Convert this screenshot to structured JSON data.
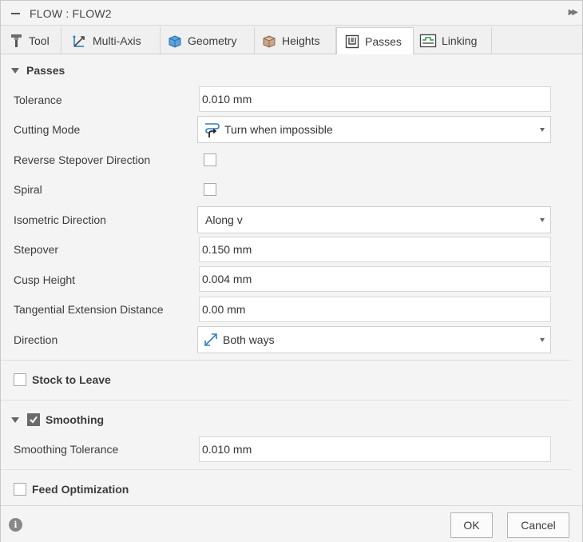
{
  "window": {
    "title": "FLOW : FLOW2"
  },
  "tabs": [
    {
      "label": "Tool",
      "icon": "tool-icon",
      "active": false
    },
    {
      "label": "Multi-Axis",
      "icon": "multi-axis-icon",
      "active": false
    },
    {
      "label": "Geometry",
      "icon": "geometry-icon",
      "active": false
    },
    {
      "label": "Heights",
      "icon": "heights-icon",
      "active": false
    },
    {
      "label": "Passes",
      "icon": "passes-icon",
      "active": true
    },
    {
      "label": "Linking",
      "icon": "linking-icon",
      "active": false
    }
  ],
  "passes": {
    "title": "Passes",
    "tolerance": {
      "label": "Tolerance",
      "value": "0.010 mm"
    },
    "cutting_mode": {
      "label": "Cutting Mode",
      "value": "Turn when impossible",
      "icon": "turn-when-impossible-icon"
    },
    "reverse_stepover": {
      "label": "Reverse Stepover Direction",
      "checked": false
    },
    "spiral": {
      "label": "Spiral",
      "checked": false
    },
    "isometric_direction": {
      "label": "Isometric Direction",
      "value": "Along v"
    },
    "stepover": {
      "label": "Stepover",
      "value": "0.150 mm"
    },
    "cusp_height": {
      "label": "Cusp Height",
      "value": "0.004 mm"
    },
    "tangential_extension": {
      "label": "Tangential Extension Distance",
      "value": "0.00 mm"
    },
    "direction": {
      "label": "Direction",
      "value": "Both ways",
      "icon": "both-ways-icon"
    }
  },
  "stock_to_leave": {
    "label": "Stock to Leave",
    "checked": false
  },
  "smoothing": {
    "label": "Smoothing",
    "checked": true,
    "tolerance": {
      "label": "Smoothing Tolerance",
      "value": "0.010 mm"
    }
  },
  "feed_optimization": {
    "label": "Feed Optimization",
    "checked": false
  },
  "footer": {
    "info_icon": "info-icon",
    "ok_label": "OK",
    "cancel_label": "Cancel"
  },
  "colors": {
    "checkbox_checked": "#6b6b6b",
    "icon_blue": "#2f7fc1",
    "background": "#f4f4f4"
  }
}
